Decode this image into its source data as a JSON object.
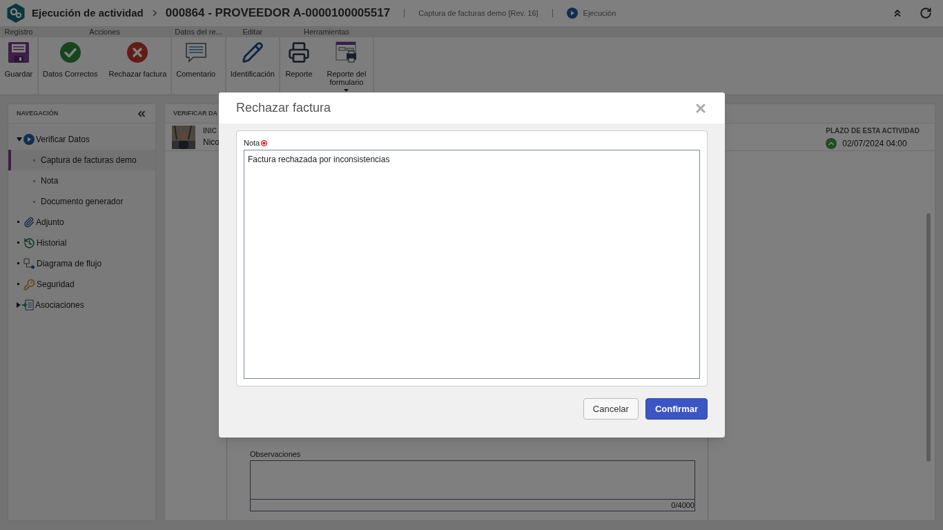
{
  "header": {
    "title": "Ejecución de actividad",
    "record": "000864 - PROVEEDOR A-0000100005517",
    "process": "Captura de facturas demo [Rev. 16]",
    "status": "Ejecución"
  },
  "ribbon": {
    "groups": [
      {
        "label": "Registro",
        "buttons": [
          {
            "label": "Guardar",
            "kind": "save",
            "dropdown": false
          }
        ]
      },
      {
        "label": "Acciones",
        "buttons": [
          {
            "label": "Datos Correctos",
            "kind": "approve",
            "dropdown": false
          },
          {
            "label": "Rechazar factura",
            "kind": "reject",
            "dropdown": false
          }
        ]
      },
      {
        "label": "Datos del re...",
        "buttons": [
          {
            "label": "Comentario",
            "kind": "comment",
            "dropdown": false
          }
        ]
      },
      {
        "label": "Editar",
        "buttons": [
          {
            "label": "Identificación",
            "kind": "edit",
            "dropdown": false
          }
        ]
      },
      {
        "label": "Herramientas",
        "buttons": [
          {
            "label": "Reporte",
            "kind": "print",
            "dropdown": false
          },
          {
            "label": "Reporte del formulario",
            "kind": "form",
            "dropdown": true
          }
        ]
      }
    ]
  },
  "navigation": {
    "title": "NAVEGACIÓN",
    "items": [
      {
        "label": "Verificar Datos",
        "kind": "play",
        "expanded": true,
        "children": [
          {
            "label": "Captura de facturas demo",
            "selected": true
          },
          {
            "label": "Nota",
            "selected": false
          },
          {
            "label": "Documento generador",
            "selected": false
          }
        ]
      },
      {
        "label": "Adjunto",
        "kind": "attach",
        "expanded": false
      },
      {
        "label": "Historial",
        "kind": "history",
        "expanded": false
      },
      {
        "label": "Diagrama de flujo",
        "kind": "flow",
        "expanded": false
      },
      {
        "label": "Seguridad",
        "kind": "key",
        "expanded": false
      },
      {
        "label": "Asociaciones",
        "kind": "assoc",
        "expanded": false,
        "expandable": true
      }
    ]
  },
  "content": {
    "heading": "VERIFICAR DA",
    "starter_label": "INIC",
    "starter_name": "Nico",
    "deadline_label": "PLAZO DE ESTA ACTIVIDAD",
    "deadline": "02/07/2024 04:00",
    "observations_label": "Observaciones",
    "counter": "0/4000"
  },
  "dialog": {
    "title": "Rechazar factura",
    "field_label": "Nota",
    "required": true,
    "value": "Factura rechazada por inconsistencias",
    "buttons": [
      {
        "label": "Cancelar",
        "primary": false
      },
      {
        "label": "Confirmar",
        "primary": true
      }
    ]
  }
}
